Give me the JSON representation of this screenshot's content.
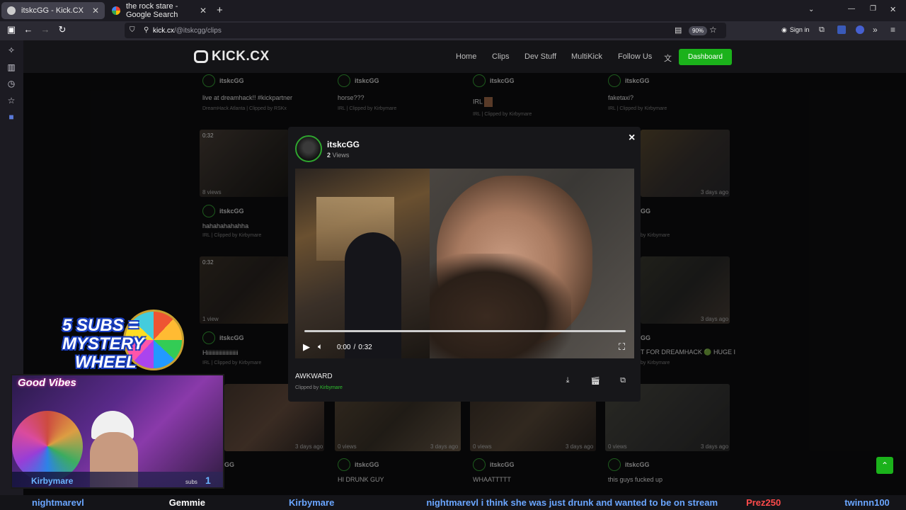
{
  "browser": {
    "tabs": [
      {
        "title": "itskcGG - Kick.CX",
        "active": true
      },
      {
        "title": "the rock stare - Google Search",
        "active": false
      }
    ],
    "new_tab": "+",
    "url_host": "kick.cx",
    "url_path": "/@itskcgg/clips",
    "zoom": "90%",
    "sign_in": "Sign in"
  },
  "site": {
    "logo": "KICK.CX",
    "menu": [
      "Home",
      "Clips",
      "Dev Stuff",
      "MultiKick",
      "Follow Us"
    ],
    "dashboard": "Dashboard"
  },
  "top_row": [
    {
      "channel": "itskcGG",
      "title": "live at dreamhack!! #kickpartner",
      "sub": "DreamHack Atlanta | Clipped by RSKx"
    },
    {
      "channel": "itskcGG",
      "title": "horse???",
      "sub": "IRL | Clipped by Kirbymare"
    },
    {
      "channel": "itskcGG",
      "title": "IRL",
      "sub": "IRL | Clipped by Kirbymare"
    },
    {
      "channel": "itskcGG",
      "title": "faketaxi?",
      "sub": "IRL | Clipped by Kirbymare"
    }
  ],
  "row2": {
    "left": {
      "duration": "0:32",
      "views": "8 views",
      "channel": "itskcGG",
      "title": "hahahahahahha",
      "sub": "IRL | Clipped by Kirbymare"
    },
    "right": {
      "age": "3 days ago",
      "channel": "GG",
      "sub": "by Kirbymare"
    }
  },
  "row3": {
    "left": {
      "duration": "0:32",
      "views": "1 view",
      "channel": "itskcGG",
      "title": "Hiiiiiiiiiiiiiiiiiiiiii",
      "sub": "IRL | Clipped by Kirbymare"
    },
    "right": {
      "age": "3 days ago",
      "channel": "GG",
      "title": "T FOR DREAMHACK 🟢 HUGE I",
      "sub": "by Kirbymare"
    }
  },
  "row4": [
    {
      "views": "",
      "age": "3 days ago",
      "channel": "GG",
      "title": ""
    },
    {
      "views": "0 views",
      "age": "3 days ago",
      "channel": "itskcGG",
      "title": "HI DRUNK GUY"
    },
    {
      "views": "0 views",
      "age": "3 days ago",
      "channel": "itskcGG",
      "title": "WHAATTTTT"
    },
    {
      "views": "0 views",
      "age": "3 days ago",
      "channel": "itskcGG",
      "title": "this guys fucked up"
    }
  ],
  "modal": {
    "channel": "itskcGG",
    "views_count": "2",
    "views_label": "Views",
    "close": "×",
    "time_current": "0:00",
    "time_sep": "/",
    "time_total": "0:32",
    "playback_fraction": 0.0,
    "clip_title": "AWKWARD",
    "clipped_by_label": "Clipped by",
    "clipped_by_user": "Kirbymare"
  },
  "stream": {
    "wheel_line1": "5 SUBS =",
    "wheel_line2": "MYSTERY",
    "wheel_line3": "WHEEL",
    "cam_banner": "Good Vibes",
    "cam_name": "Kirbymare",
    "subs_label": "subs",
    "subs_count": "1",
    "ticker": [
      "nightmarevl",
      "Gemmie",
      "Kirbymare",
      "nightmarevl i think she was just drunk and wanted to be on stream",
      "Prez250",
      "twinnn100"
    ]
  },
  "colors": {
    "accent": "#1bb21b",
    "ticker_blue": "#6aa6ff",
    "ticker_red": "#ff4b4b"
  },
  "icons": [
    "back-icon",
    "forward-icon",
    "reload-icon",
    "shield-icon",
    "star-icon",
    "play-icon",
    "volume-icon",
    "fullscreen-icon",
    "download-icon",
    "clapper-icon",
    "copy-icon",
    "translate-icon",
    "chevron-up-icon"
  ]
}
